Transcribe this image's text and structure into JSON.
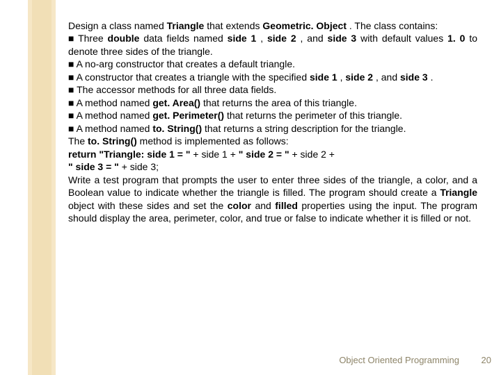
{
  "glyphs": {
    "square": "■"
  },
  "body": {
    "p0": {
      "a": "Design a class named ",
      "b": "Triangle",
      "c": " that extends ",
      "d": "Geometric. Object",
      "e": ". The class contains:"
    },
    "p1": {
      "a": " Three ",
      "b": "double",
      "c": " data fields named ",
      "d": "side 1",
      "e": ", ",
      "f": "side 2",
      "g": ", and ",
      "h": "side 3",
      "i": " with default values ",
      "j": "1. 0",
      "k": " to denote three sides of the triangle."
    },
    "p2": {
      "a": " A no-arg constructor that creates a default triangle."
    },
    "p3": {
      "a": " A constructor that creates a triangle with the specified ",
      "b": "side 1",
      "c": ", ",
      "d": "side 2",
      "e": ", and ",
      "f": "side 3",
      "g": "."
    },
    "p4": {
      "a": " The accessor methods for all three data fields."
    },
    "p5": {
      "a": " A method named ",
      "b": "get. Area()",
      "c": " that returns the area of this triangle."
    },
    "p6": {
      "a": " A method named ",
      "b": "get. Perimeter()",
      "c": " that returns the perimeter of this triangle."
    },
    "p7": {
      "a": " A method named ",
      "b": "to. String()",
      "c": " that returns a string description for the triangle."
    },
    "p8": {
      "a": "The ",
      "b": "to. String()",
      "c": " method is implemented as follows:"
    },
    "p9": {
      "a": "return \"Triangle: side 1 = \" ",
      "b": "+ side 1 + ",
      "c": "\" side 2 = \" ",
      "d": "+ side 2 +"
    },
    "p10": {
      "a": "\" side 3 = \" ",
      "b": "+ side 3;"
    },
    "p11": {
      "a": "Write a test program that prompts the user to enter three sides of the triangle, a color, and a Boolean value to indicate whether the triangle is filled. The program should create a ",
      "b": "Triangle",
      "c": " object with these sides and set the ",
      "d": "color",
      "e": " and ",
      "f": "filled",
      "g": " properties using the input. The program should display the area, perimeter, color, and true or false to indicate whether it is filled or not."
    }
  },
  "footer": {
    "label": "Object Oriented Programming",
    "page": "20"
  }
}
